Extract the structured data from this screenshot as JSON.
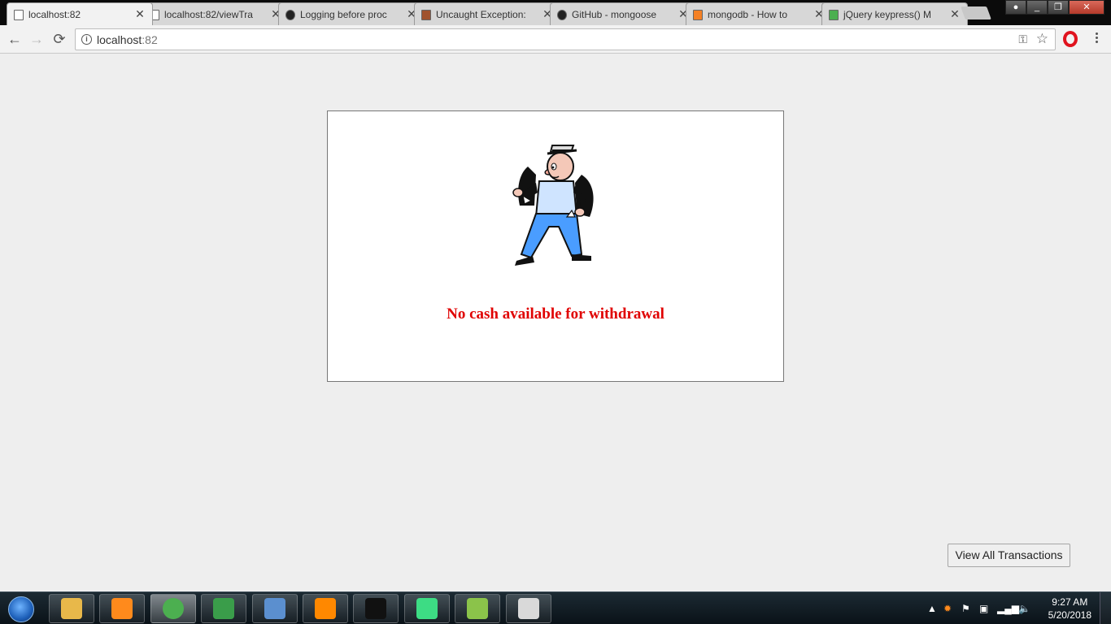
{
  "window": {
    "tabs": [
      {
        "title": "localhost:82",
        "icon": "page-icon",
        "active": true
      },
      {
        "title": "localhost:82/viewTra",
        "icon": "page-icon",
        "active": false
      },
      {
        "title": "Logging before proc",
        "icon": "github-icon",
        "active": false
      },
      {
        "title": "Uncaught Exception:",
        "icon": "avatar-icon",
        "active": false
      },
      {
        "title": "GitHub - mongoose",
        "icon": "github-icon",
        "active": false
      },
      {
        "title": "mongodb - How to",
        "icon": "stackoverflow-icon",
        "active": false
      },
      {
        "title": "jQuery keypress() M",
        "icon": "w3schools-icon",
        "active": false
      }
    ],
    "close_glyph": "✕"
  },
  "toolbar": {
    "back": "←",
    "forward": "→",
    "reload": "⟳",
    "url_host": "localhost",
    "url_port": ":82"
  },
  "page": {
    "message": "No cash available for withdrawal",
    "view_all_label": "View All Transactions",
    "illustration": "empty-pockets-man-illustration"
  },
  "taskbar": {
    "apps": [
      {
        "name": "file-explorer",
        "color": "#e8b84a"
      },
      {
        "name": "media-player",
        "color": "#ff8a1c"
      },
      {
        "name": "chrome",
        "color": "#4caf50",
        "active": true
      },
      {
        "name": "network-app",
        "color": "#3a9d4a"
      },
      {
        "name": "virtualbox",
        "color": "#5b8fcf"
      },
      {
        "name": "vlc",
        "color": "#ff8800"
      },
      {
        "name": "command-prompt",
        "color": "#111111"
      },
      {
        "name": "android-studio",
        "color": "#3ddc84"
      },
      {
        "name": "notepad-plus-plus",
        "color": "#8bc34a"
      },
      {
        "name": "paint",
        "color": "#d9d9d9"
      }
    ],
    "time": "9:27 AM",
    "date": "5/20/2018"
  },
  "colors": {
    "message": "#e00000",
    "page_bg": "#eeeeee"
  }
}
